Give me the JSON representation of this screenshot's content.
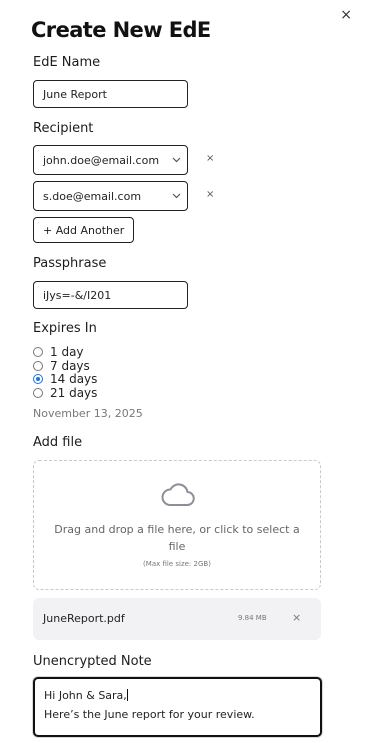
{
  "dialog": {
    "title": "Create New EdE",
    "close_glyph": "×"
  },
  "name_section": {
    "label": "EdE Name",
    "value": "June Report"
  },
  "recipient_section": {
    "label": "Recipient",
    "recipients": [
      {
        "value": "john.doe@email.com",
        "remove_glyph": "×"
      },
      {
        "value": "s.doe@email.com",
        "remove_glyph": "×"
      }
    ],
    "add_label": "+ Add Another"
  },
  "passphrase_section": {
    "label": "Passphrase",
    "value": "iJys=-&/I201"
  },
  "expires_section": {
    "label": "Expires In",
    "options": [
      {
        "label": "1 day",
        "selected": false
      },
      {
        "label": "7 days",
        "selected": false
      },
      {
        "label": "14 days",
        "selected": true
      },
      {
        "label": "21 days",
        "selected": false
      }
    ],
    "expiry_date": "November 13, 2025"
  },
  "file_section": {
    "label": "Add file",
    "dropzone_icon": "cloud-icon",
    "dropzone_text": "Drag and drop a file here, or click to select a file",
    "dropzone_subtext": "(Max file size: 2GB)",
    "attached_file": {
      "name": "JuneReport.pdf",
      "size": "9.84 MB",
      "remove_glyph": "×"
    }
  },
  "note_section": {
    "label": "Unencrypted Note",
    "lines": [
      "Hi John & Sara,",
      "Here’s the June report for your review."
    ]
  },
  "colors": {
    "accent": "#1a73e8",
    "border": "#222222",
    "muted_text": "#777777",
    "file_card_bg": "#f2f2f4"
  }
}
